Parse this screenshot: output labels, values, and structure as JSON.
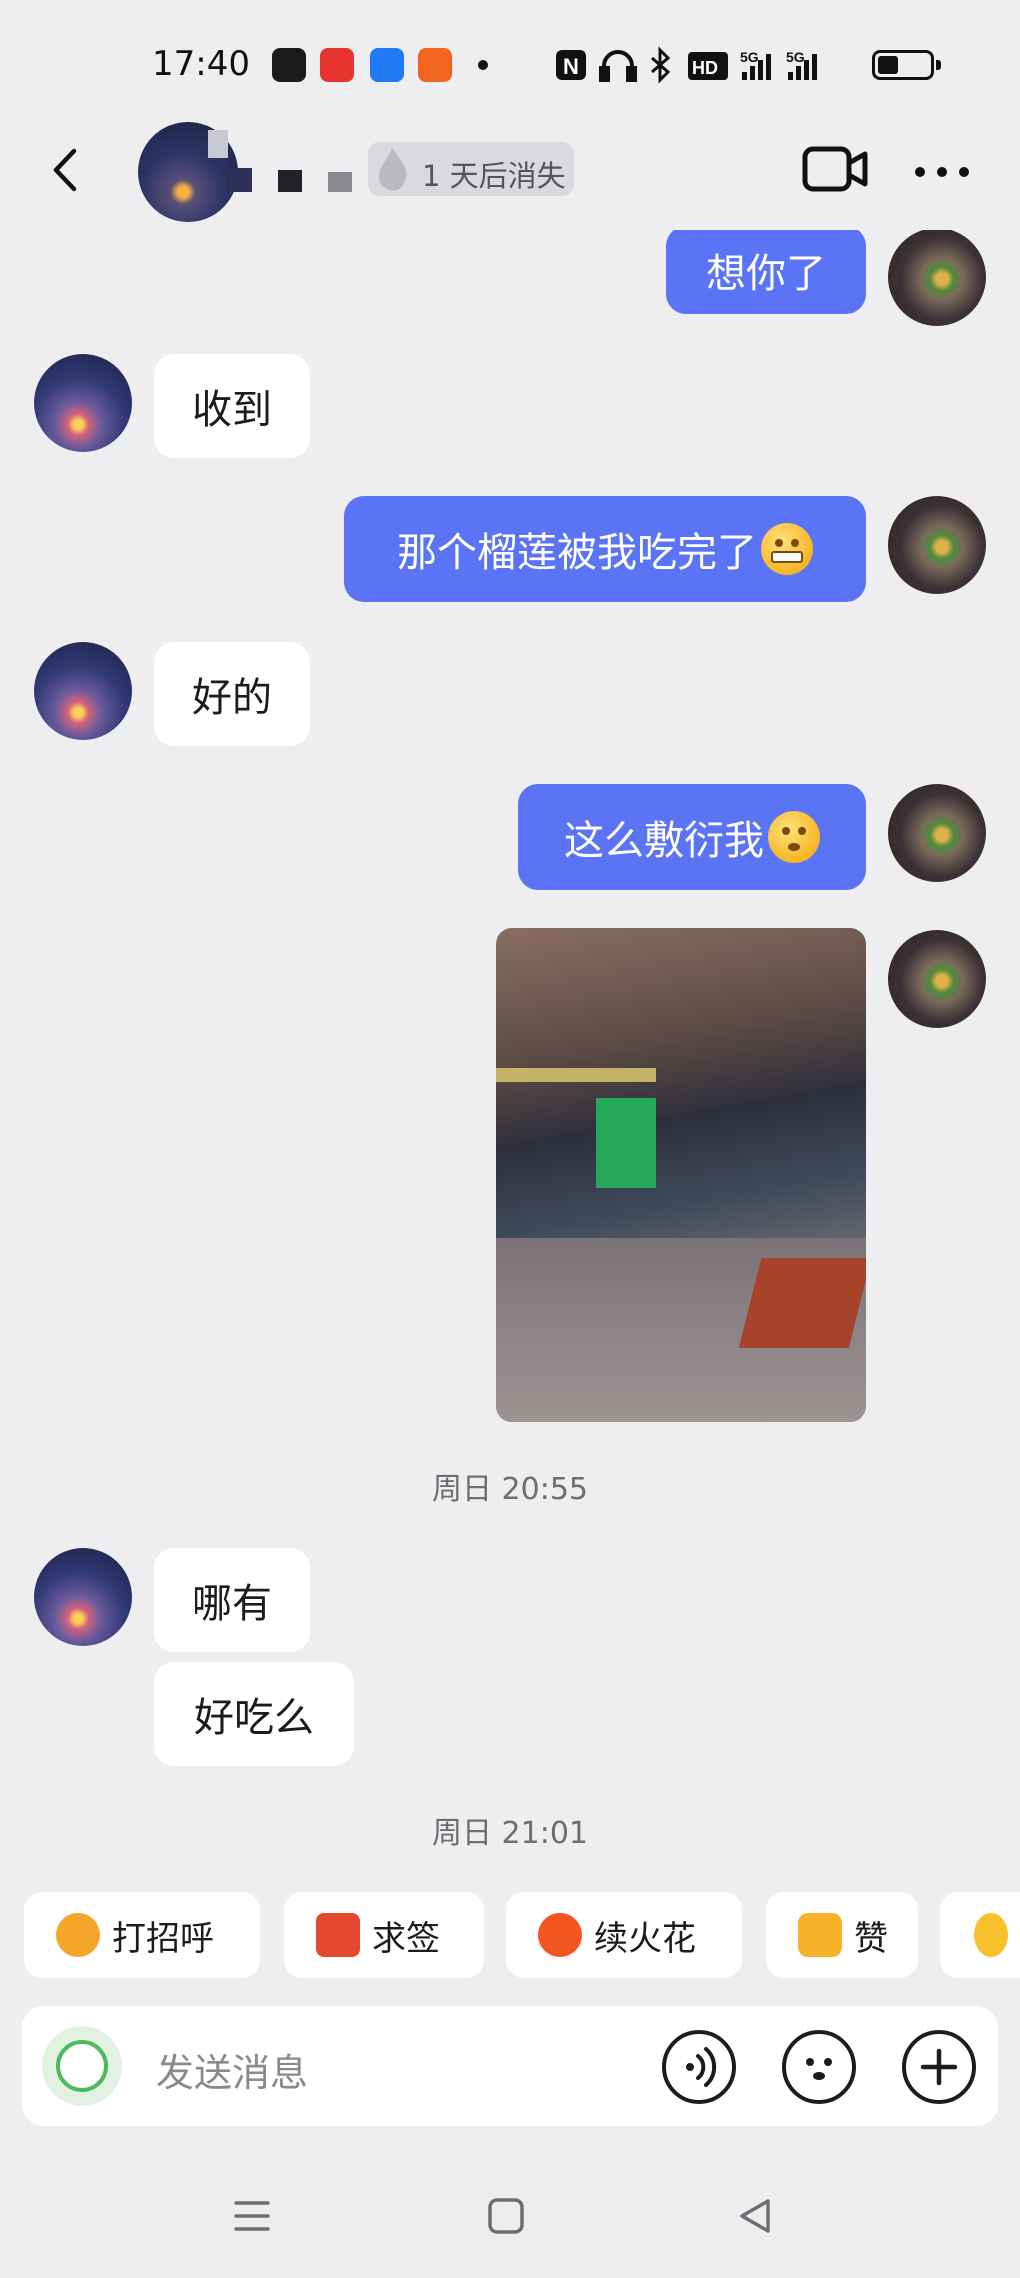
{
  "status_bar": {
    "time": "17:40",
    "network": "5G",
    "icons": [
      "nfc-icon",
      "headphones-icon",
      "bluetooth-icon",
      "hd-icon",
      "signal-icon",
      "battery-icon"
    ]
  },
  "header": {
    "disappear_label": "1 天后消失"
  },
  "messages": [
    {
      "side": "out",
      "text": "想你了"
    },
    {
      "side": "in",
      "text": "收到"
    },
    {
      "side": "out",
      "text": "那个榴莲被我吃完了"
    },
    {
      "side": "in",
      "text": "好的"
    },
    {
      "side": "out",
      "text": "这么敷衍我"
    },
    {
      "side": "out",
      "type": "image"
    },
    {
      "side": "in",
      "text": "哪有"
    },
    {
      "side": "in",
      "text": "好吃么"
    }
  ],
  "timestamps": [
    "周日 20:55",
    "周日 21:01"
  ],
  "quick_actions": [
    {
      "label": "打招呼",
      "icon": "wave-emoji-icon",
      "color": "#F6A62A"
    },
    {
      "label": "求签",
      "icon": "fortune-stick-icon",
      "color": "#E5472F"
    },
    {
      "label": "续火花",
      "icon": "flame-icon",
      "color": "#F2551E"
    },
    {
      "label": "赞",
      "icon": "thumbs-up-icon",
      "color": "#F6B32A"
    }
  ],
  "composer": {
    "placeholder": "发送消息"
  },
  "colors": {
    "outgoing_bubble": "#5B73F5",
    "incoming_bubble": "#FFFFFF",
    "background": "#EEEDF0"
  }
}
